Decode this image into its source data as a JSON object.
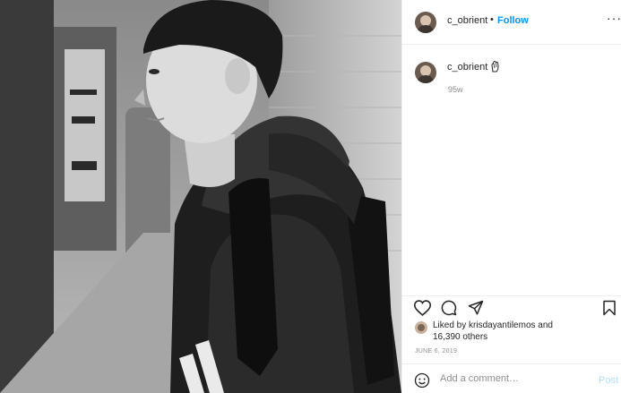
{
  "post": {
    "username": "c_obrient",
    "follow_separator": "•",
    "follow_label": "Follow",
    "more_label": "···",
    "caption_username": "c_obrient",
    "caption_age": "95w",
    "liked_prefix": "Liked by ",
    "liked_user": "krisdayantilemos",
    "liked_and": " and",
    "liked_others": "16,390 others",
    "date": "JUNE 6, 2019",
    "comment_placeholder": "Add a comment…",
    "post_label": "Post"
  },
  "icons": {
    "like": "heart-icon",
    "comment": "comment-icon",
    "share": "share-icon",
    "save": "bookmark-icon",
    "emoji": "smiley-icon",
    "caption_emoji": "hand-icon"
  },
  "colors": {
    "link": "#0095f6",
    "muted": "#8e8e8e",
    "post_disabled": "#b2dffc",
    "text": "#262626"
  }
}
